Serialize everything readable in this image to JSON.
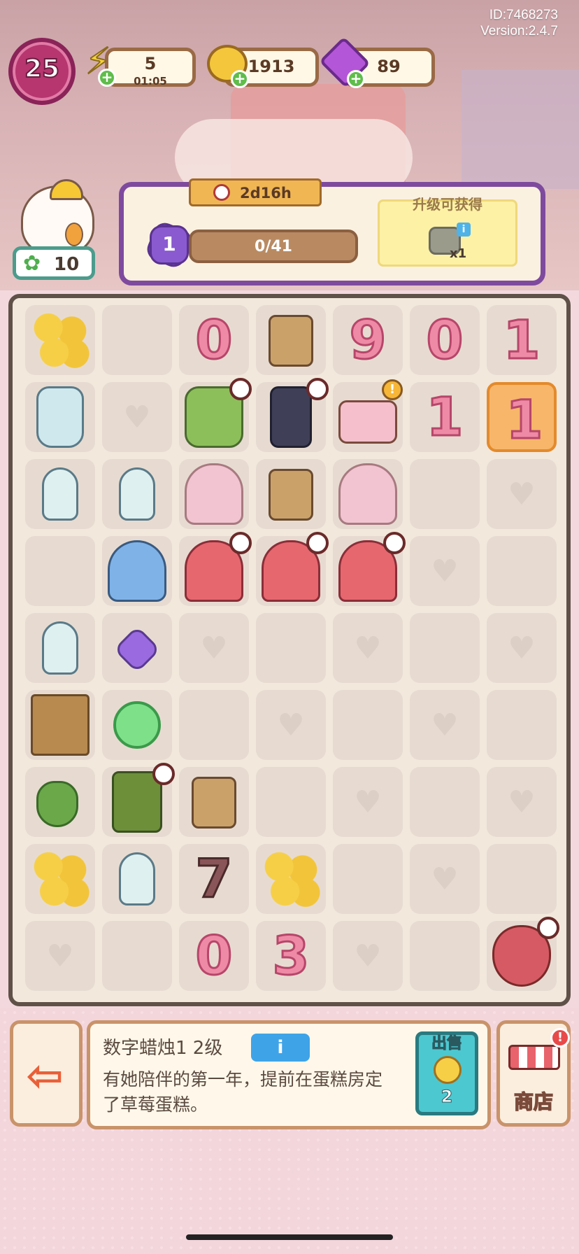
{
  "header": {
    "id_text": "ID:7468273",
    "version_text": "Version:2.4.7",
    "level": "25",
    "energy": {
      "value": "5",
      "timer": "01:05",
      "icon": "lightning-icon"
    },
    "coins": {
      "value": "1913",
      "icon": "coin-icon"
    },
    "gems": {
      "value": "89",
      "icon": "gem-icon"
    }
  },
  "character": {
    "clover_count": "10"
  },
  "upgrade_panel": {
    "timer": "2d16h",
    "stage": "1",
    "progress_text": "0/41",
    "progress_fraction": 0,
    "reward_label": "升级可获得",
    "reward_qty": "x1"
  },
  "board": {
    "rows": [
      [
        "coins",
        "",
        "candle-0",
        "music-box",
        "candle-9",
        "candle-0",
        "candle-1"
      ],
      [
        "jar",
        "heart",
        "cactus-pot",
        "lighter",
        "cake",
        "candle-1",
        "candle-1-selected"
      ],
      [
        "bottle",
        "bottle-small",
        "cherry-tree",
        "music-box",
        "cherry-tree",
        "",
        "heart"
      ],
      [
        "",
        "umbrella",
        "xmas-tree",
        "xmas-tree",
        "xmas-tree",
        "heart",
        ""
      ],
      [
        "bottle",
        "purple-star",
        "heart",
        "",
        "heart",
        "",
        "heart"
      ],
      [
        "crate",
        "candy",
        "",
        "heart",
        "",
        "heart",
        ""
      ],
      [
        "pouch",
        "clock",
        "music-box",
        "",
        "heart",
        "",
        "heart"
      ],
      [
        "coins",
        "bottle-small",
        "candle-7-burnt",
        "coins",
        "",
        "heart",
        ""
      ],
      [
        "heart",
        "",
        "candle-0",
        "candle-3",
        "heart",
        "",
        "broken-heart"
      ]
    ],
    "candle_digits": {
      "candle-0": "0",
      "candle-9": "9",
      "candle-1": "1",
      "candle-1-selected": "1",
      "candle-3": "3",
      "candle-7-burnt": "7"
    },
    "timers": [
      "1-2",
      "1-3",
      "3-2",
      "3-3",
      "3-4",
      "6-1",
      "8-6"
    ],
    "alerts": [
      "1-4"
    ]
  },
  "bottom": {
    "item_title": "数字蜡烛1 2级",
    "info_button": "i",
    "description": "有她陪伴的第一年，提前在蛋糕房定了草莓蛋糕。",
    "sell_label": "出售",
    "sell_price": "2",
    "shop_label": "商店",
    "shop_badge": "!"
  },
  "colors": {
    "accent_purple": "#7e4a9e",
    "board_border": "#5f5048",
    "selected": "#f7b66a"
  }
}
